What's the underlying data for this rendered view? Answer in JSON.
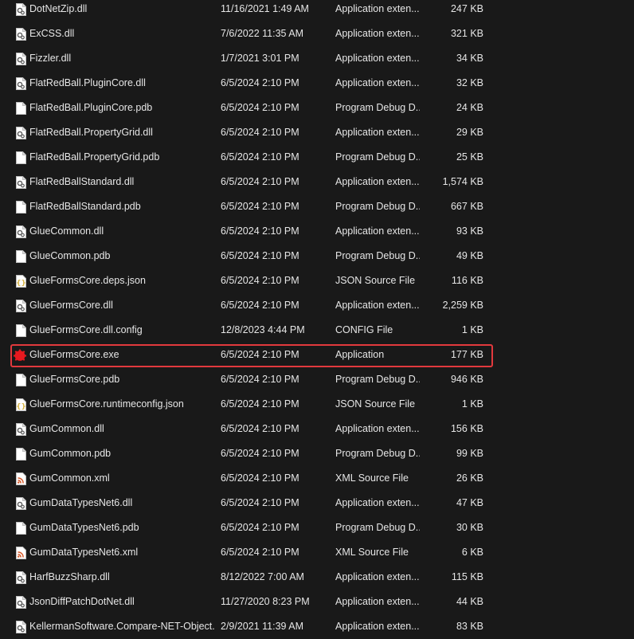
{
  "files": [
    {
      "name": "DotNetZip.dll",
      "date": "11/16/2021 1:49 AM",
      "type": "Application exten...",
      "size": "247 KB",
      "icon": "dll-icon"
    },
    {
      "name": "ExCSS.dll",
      "date": "7/6/2022 11:35 AM",
      "type": "Application exten...",
      "size": "321 KB",
      "icon": "dll-icon"
    },
    {
      "name": "Fizzler.dll",
      "date": "1/7/2021 3:01 PM",
      "type": "Application exten...",
      "size": "34 KB",
      "icon": "dll-icon"
    },
    {
      "name": "FlatRedBall.PluginCore.dll",
      "date": "6/5/2024 2:10 PM",
      "type": "Application exten...",
      "size": "32 KB",
      "icon": "dll-icon"
    },
    {
      "name": "FlatRedBall.PluginCore.pdb",
      "date": "6/5/2024 2:10 PM",
      "type": "Program Debug D...",
      "size": "24 KB",
      "icon": "file-icon"
    },
    {
      "name": "FlatRedBall.PropertyGrid.dll",
      "date": "6/5/2024 2:10 PM",
      "type": "Application exten...",
      "size": "29 KB",
      "icon": "dll-icon"
    },
    {
      "name": "FlatRedBall.PropertyGrid.pdb",
      "date": "6/5/2024 2:10 PM",
      "type": "Program Debug D...",
      "size": "25 KB",
      "icon": "file-icon"
    },
    {
      "name": "FlatRedBallStandard.dll",
      "date": "6/5/2024 2:10 PM",
      "type": "Application exten...",
      "size": "1,574 KB",
      "icon": "dll-icon"
    },
    {
      "name": "FlatRedBallStandard.pdb",
      "date": "6/5/2024 2:10 PM",
      "type": "Program Debug D...",
      "size": "667 KB",
      "icon": "file-icon"
    },
    {
      "name": "GlueCommon.dll",
      "date": "6/5/2024 2:10 PM",
      "type": "Application exten...",
      "size": "93 KB",
      "icon": "dll-icon"
    },
    {
      "name": "GlueCommon.pdb",
      "date": "6/5/2024 2:10 PM",
      "type": "Program Debug D...",
      "size": "49 KB",
      "icon": "file-icon"
    },
    {
      "name": "GlueFormsCore.deps.json",
      "date": "6/5/2024 2:10 PM",
      "type": "JSON Source File",
      "size": "116 KB",
      "icon": "json-icon"
    },
    {
      "name": "GlueFormsCore.dll",
      "date": "6/5/2024 2:10 PM",
      "type": "Application exten...",
      "size": "2,259 KB",
      "icon": "dll-icon"
    },
    {
      "name": "GlueFormsCore.dll.config",
      "date": "12/8/2023 4:44 PM",
      "type": "CONFIG File",
      "size": "1 KB",
      "icon": "file-icon"
    },
    {
      "name": "GlueFormsCore.exe",
      "date": "6/5/2024 2:10 PM",
      "type": "Application",
      "size": "177 KB",
      "icon": "exe-icon",
      "highlighted": true
    },
    {
      "name": "GlueFormsCore.pdb",
      "date": "6/5/2024 2:10 PM",
      "type": "Program Debug D...",
      "size": "946 KB",
      "icon": "file-icon"
    },
    {
      "name": "GlueFormsCore.runtimeconfig.json",
      "date": "6/5/2024 2:10 PM",
      "type": "JSON Source File",
      "size": "1 KB",
      "icon": "json-icon"
    },
    {
      "name": "GumCommon.dll",
      "date": "6/5/2024 2:10 PM",
      "type": "Application exten...",
      "size": "156 KB",
      "icon": "dll-icon"
    },
    {
      "name": "GumCommon.pdb",
      "date": "6/5/2024 2:10 PM",
      "type": "Program Debug D...",
      "size": "99 KB",
      "icon": "file-icon"
    },
    {
      "name": "GumCommon.xml",
      "date": "6/5/2024 2:10 PM",
      "type": "XML Source File",
      "size": "26 KB",
      "icon": "xml-icon"
    },
    {
      "name": "GumDataTypesNet6.dll",
      "date": "6/5/2024 2:10 PM",
      "type": "Application exten...",
      "size": "47 KB",
      "icon": "dll-icon"
    },
    {
      "name": "GumDataTypesNet6.pdb",
      "date": "6/5/2024 2:10 PM",
      "type": "Program Debug D...",
      "size": "30 KB",
      "icon": "file-icon"
    },
    {
      "name": "GumDataTypesNet6.xml",
      "date": "6/5/2024 2:10 PM",
      "type": "XML Source File",
      "size": "6 KB",
      "icon": "xml-icon"
    },
    {
      "name": "HarfBuzzSharp.dll",
      "date": "8/12/2022 7:00 AM",
      "type": "Application exten...",
      "size": "115 KB",
      "icon": "dll-icon"
    },
    {
      "name": "JsonDiffPatchDotNet.dll",
      "date": "11/27/2020 8:23 PM",
      "type": "Application exten...",
      "size": "44 KB",
      "icon": "dll-icon"
    },
    {
      "name": "KellermanSoftware.Compare-NET-Object...",
      "date": "2/9/2021 11:39 AM",
      "type": "Application exten...",
      "size": "83 KB",
      "icon": "dll-icon"
    }
  ],
  "colors": {
    "background": "#191919",
    "text": "#e6e6e6",
    "highlight_border": "#e2393d",
    "exe_icon": "#e8191f",
    "json_icon": "#d8b64a",
    "xml_icon": "#d65a2a"
  }
}
